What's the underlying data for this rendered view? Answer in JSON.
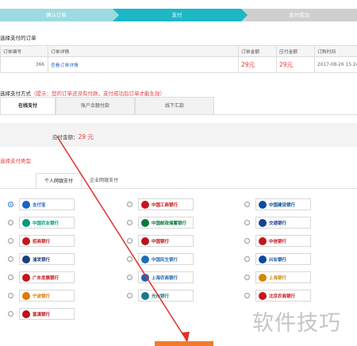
{
  "steps": [
    "确认订单",
    "支付",
    "支付成功"
  ],
  "order_section_title": "选择支付的订单",
  "order_table": {
    "headers": [
      "订单编号",
      "订单详情",
      "订单金额",
      "应付金额",
      "订购时间"
    ],
    "row": {
      "order_no": "366",
      "detail_link": "查看订单详情",
      "amount": "29元",
      "payable": "29元",
      "time": "2017-08-26 15:24:1"
    }
  },
  "pay_method": {
    "label": "选择支付方式",
    "warning": "（提示：您的订单还没有付款，支付成功后订单才能生效）"
  },
  "pay_tabs": [
    "在线支付",
    "账户余额付款",
    "线下汇款"
  ],
  "pay_amount": {
    "label": "应付金额：",
    "value": "29 元"
  },
  "bank_type_title": "选择支付类型",
  "bank_tabs": [
    "个人网银支付",
    "企业网银支付"
  ],
  "banks": [
    {
      "name": "支付宝",
      "color": "#1a63c5"
    },
    {
      "name": "中国工商银行",
      "color": "#c4161c"
    },
    {
      "name": "中国建设银行",
      "color": "#0b4ea2"
    },
    {
      "name": "中国农业银行",
      "color": "#009a7a"
    },
    {
      "name": "中国邮政储蓄银行",
      "color": "#0a7a3a"
    },
    {
      "name": "交通银行",
      "color": "#1c3f8f"
    },
    {
      "name": "招商银行",
      "color": "#c4161c"
    },
    {
      "name": "中国银行",
      "color": "#b8141a"
    },
    {
      "name": "中信银行",
      "color": "#c4161c"
    },
    {
      "name": "浦发银行",
      "color": "#1a3f7a"
    },
    {
      "name": "中国民生银行",
      "color": "#1f6fb5"
    },
    {
      "name": "兴业银行",
      "color": "#0d4a9c"
    },
    {
      "name": "广东发展银行",
      "color": "#c4161c"
    },
    {
      "name": "上海农商银行",
      "color": "#1f63b0"
    },
    {
      "name": "上海银行",
      "color": "#d08a00"
    },
    {
      "name": "宁波银行",
      "color": "#e07a00"
    },
    {
      "name": "光州银行",
      "color": "#1a7a8a"
    },
    {
      "name": "北京农商银行",
      "color": "#c4161c"
    },
    {
      "name": "富滇银行",
      "color": "#b8141a"
    }
  ],
  "watermark": "软件技巧",
  "colors": {
    "accent": "#1db7c6",
    "price": "#e4393c"
  }
}
